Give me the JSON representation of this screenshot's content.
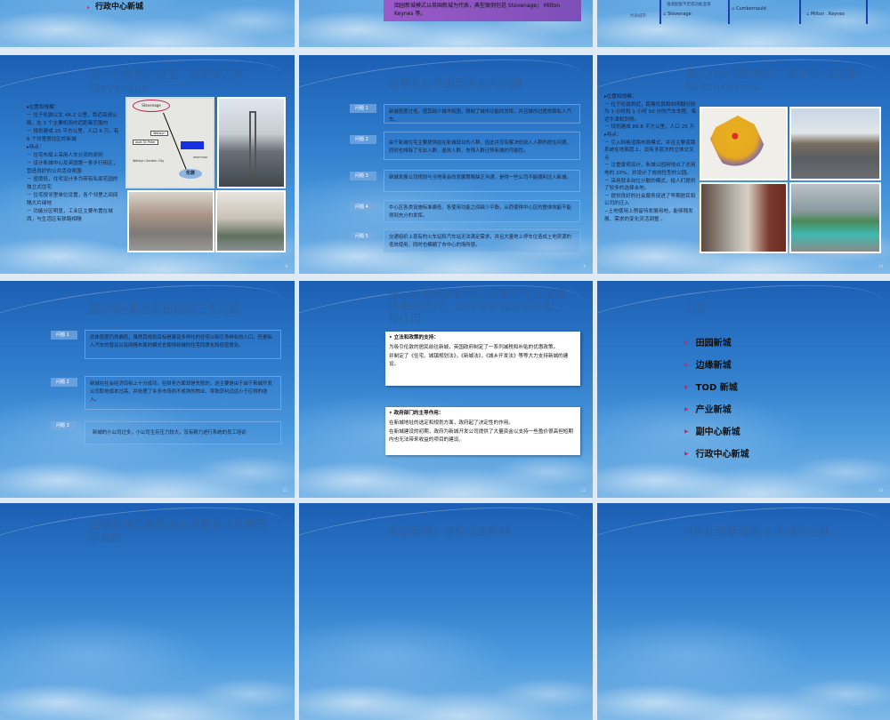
{
  "top_row": {
    "s5_item": "行政中心新城",
    "s6_box": "田园新城模式以英国新城为代表，典型案例包括 Stevenage； Milton Keynes 等。",
    "s7_header": "强调配套不足或功能混淆",
    "s7_row_label": "代表城市",
    "s7_cities": [
      "Stevenage",
      "Cumbernauld",
      "Milton . Keynes"
    ]
  },
  "slide8": {
    "number": "8",
    "title_line1": "第一代新城的典型：斯蒂文乃齐",
    "title_line2": "Stevenage",
    "lines": [
      "▸位置和规模：",
      "－ 位于伦敦以北 48.2 公里，靠近高速公路，在 3 个主要机场的近距离范围内",
      "－ 规划建成 25 平方公里，人口 6 万，有 6 个邻里居住区的新城",
      "▸特点：",
      "－ 住宅布局上采用人车分流的原则",
      "－ 设计新城中心及英国第一条步行街区，营造良好的公共活动氛围",
      "－ 密度低，住宅设计多为带有私家花园的独立式住宅",
      "－ 住宅按邻里单位设置，各个邻里之间间隔大片绿地",
      "－ 功能分区明显，工业区主要布置在城西，与生活区有铁路相隔"
    ],
    "map_labels": {
      "top": "Stevenage",
      "a": "Welwyn Garden City",
      "b": "伦敦",
      "c": "HERTFORD",
      "d": "Welwyn",
      "e": "Ayot St Peter"
    }
  },
  "slide9": {
    "number": "9",
    "title": "斯蒂文乃齐出现的五大问题",
    "problems": [
      {
        "label": "问题 1",
        "text": "新城密度过低，使其缺少城市氛围，限制了城市功能的发挥，并且城市过度依赖私人汽车。"
      },
      {
        "label": "问题 2",
        "text": "由于新城住宅主要提供给在新城就业的人群，因此并没有解决低收入人群的居住问题，同时也排除了无业人群、退休人群、伤残人群迁移新城的可能性。"
      },
      {
        "label": "问题 3",
        "text": "新城发展公司规划与当地商会的发展策略缺乏沟通，是得一些公司不能顺利迁入新城。"
      },
      {
        "label": "问题 4",
        "text": "中心区各类设施标准偏低，各使用功能之间缺少平衡，从而使得中心区的整体效能不能得到充分的发挥。"
      },
      {
        "label": "问题 5",
        "text": "交通组织上现有的火车站和汽车站无法满足需求，并且大量地上停车位造成土地资源的低效使用，同时也模糊了市中心的场所感。"
      }
    ]
  },
  "slide10": {
    "number": "10",
    "title_line1": "第三代新城的典型：密尔顿•凯恩斯",
    "title_line2": "MiltonKeynes",
    "lines": [
      "▸位置和规模：",
      "－ 位于伦敦附近，距离伦敦和伯明翰分别为 1 小时和 1 小时 50 分的汽车车程，临近牛津和剑桥。",
      "－ 规划建成 88.8 平方公里，人口 25 万",
      "▸特点：",
      "－ 引入网格道路布局模式，并且主要道路系统在地面层上，设有多层次的立体交叉点",
      "－ 注重景观设计，新城公园用地占了总用地的 20%，并设计了成线性型的公园。",
      "－ 采用就业岗位分散的模式，给人们提供了较多的选择余地。",
      "－ 提供良好的社会服务促进了早期居民和公司的迁入",
      "−土地使用上预留待发展用地，能够随发展、需求的变化灵活调整 。"
    ]
  },
  "slide11": {
    "number": "11",
    "title": "密尔顿•凯恩斯出现的三大问题",
    "problems": [
      {
        "label": "问题 1",
        "text": "总体密度仍然偏低，虽然其规划目标是建设多样化的住宅以吸引多样化的人口，但是私人汽车的普及以及网格布局的模式也使得新城的住宅同质化和低密度化。"
      },
      {
        "label": "问题 2",
        "text": "新城在社会经济目标上十分成功，在财务方面却是失败的，这主要是由于由于新城开发公司取地成本过高，并处理了许多市场尚不成熟的物业，导致获利远远小于应得的收入。"
      },
      {
        "label": "问题 3",
        "text": "新城的小公司过多，小公司生存压力较大，没有精力进行系统的员工培训"
      }
    ]
  },
  "slide12": {
    "number": "12",
    "title": "田园新城模式的成功关键在于立法和政策的支持，政府在新城建设中起主导作用",
    "box1": {
      "heading": "立法和政策的支持：",
      "p1": "为吸引伦敦的居民前往新城，英国政府制定了一系列减税和补贴的优惠政策。",
      "p2": "并制定了《住宅、城镇规划法》，《新城法》，《城乡开发法》等等大力支持新城的建设。"
    },
    "box2": {
      "heading": "政府部门的主导作用：",
      "p1": "在新城地址的选定和规划方面，政府起了决定性的作用。",
      "p2": "在新城建设的初期，政府为新城开发公司提供了大量资金以支持一些盈价很高但短期内也无法带来收益的项目的建设。"
    }
  },
  "slide13": {
    "number": "13",
    "title": "目录",
    "items": [
      "田园新城",
      "边缘新城",
      "TOD 新城",
      "产业新城",
      "副中心新城",
      "行政中心新城"
    ]
  },
  "bottom_row": {
    "s14_title": "边缘新城是随着城市郊区化的发展而形成的",
    "s15_title": "典型案例：哥伦比亚新城",
    "s16_title": "哥伦比亚新城的 5 大成功之处"
  },
  "colors": {
    "slide_blue": "#2f7dcc",
    "gap": "#dfeaf4",
    "bullet": "#b0307a",
    "title": "#2d5f9e",
    "purple_box": "#8a55c0"
  }
}
